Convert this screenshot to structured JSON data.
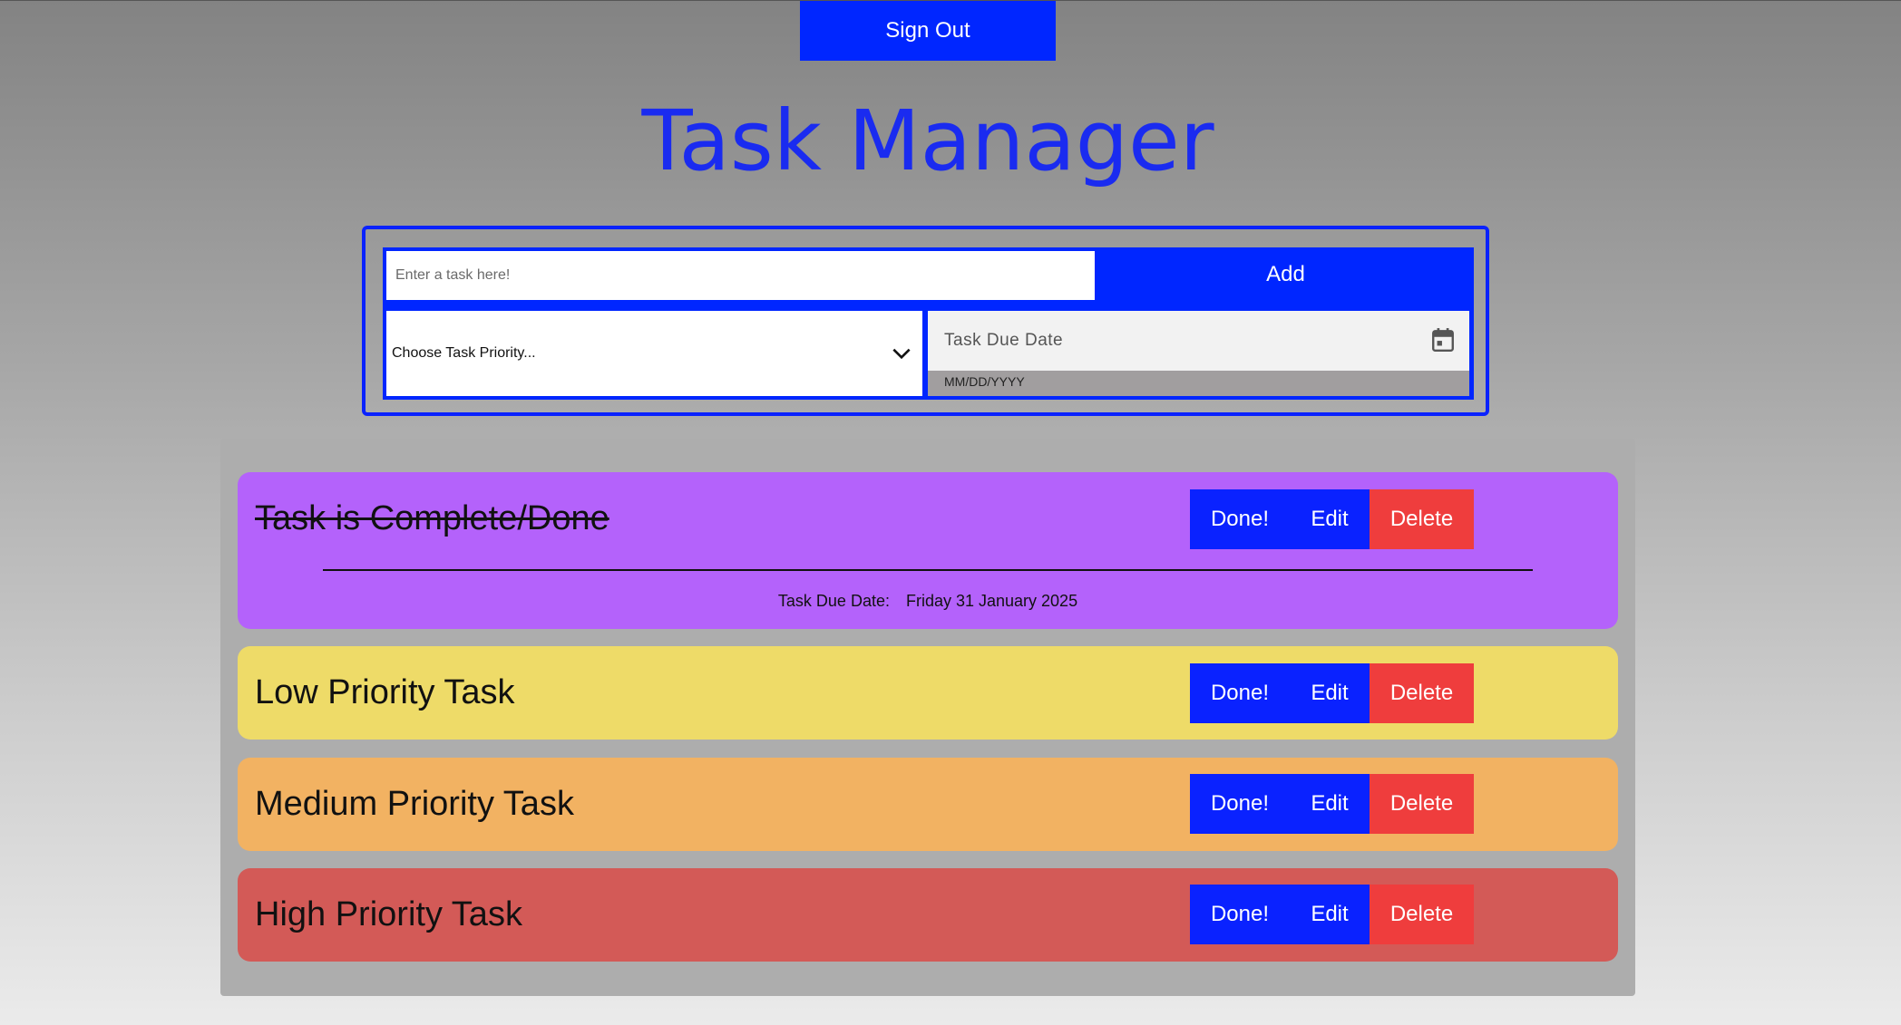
{
  "header": {
    "sign_out_label": "Sign Out",
    "title": "Task Manager"
  },
  "form": {
    "task_placeholder": "Enter a task here!",
    "add_label": "Add",
    "priority_placeholder": "Choose Task Priority...",
    "due_date_label": "Task Due Date",
    "due_date_format": "MM/DD/YYYY"
  },
  "tasks": [
    {
      "name": "Task is Complete/Done",
      "done": true,
      "color": "#b462fb",
      "due_label": "Task Due Date:",
      "due_value": "Friday 31 January 2025",
      "done_label": "Done!",
      "edit_label": "Edit",
      "delete_label": "Delete"
    },
    {
      "name": "Low Priority Task",
      "done": false,
      "color": "#eedb68",
      "done_label": "Done!",
      "edit_label": "Edit",
      "delete_label": "Delete"
    },
    {
      "name": "Medium Priority Task",
      "done": false,
      "color": "#f2b262",
      "done_label": "Done!",
      "edit_label": "Edit",
      "delete_label": "Delete"
    },
    {
      "name": "High Priority Task",
      "done": false,
      "color": "#d35a57",
      "done_label": "Done!",
      "edit_label": "Edit",
      "delete_label": "Delete"
    }
  ],
  "colors": {
    "accent_blue": "#0026ff",
    "delete_red": "#ef3d3d",
    "title_blue": "#1a2bf0"
  },
  "icons": {
    "priority_dropdown": "chevron-down-icon",
    "date_picker": "calendar-icon"
  }
}
